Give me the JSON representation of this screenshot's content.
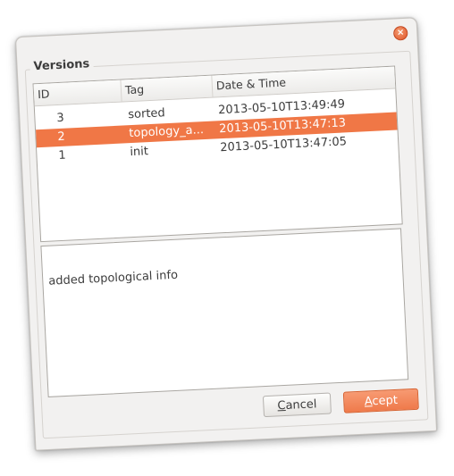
{
  "dialog": {
    "title": "Versions",
    "close_icon": "close-icon",
    "accent_color": "#f07746"
  },
  "table": {
    "columns": [
      "ID",
      "Tag",
      "Date & Time"
    ],
    "rows": [
      {
        "id": "3",
        "tag": "sorted",
        "datetime": "2013-05-10T13:49:49",
        "selected": false
      },
      {
        "id": "2",
        "tag": "topology_a...",
        "datetime": "2013-05-10T13:47:13",
        "selected": true
      },
      {
        "id": "1",
        "tag": "init",
        "datetime": "2013-05-10T13:47:05",
        "selected": false
      }
    ]
  },
  "notes": {
    "text": "added topological info"
  },
  "buttons": {
    "cancel_label": "Cancel",
    "accept_label": "Acept"
  }
}
